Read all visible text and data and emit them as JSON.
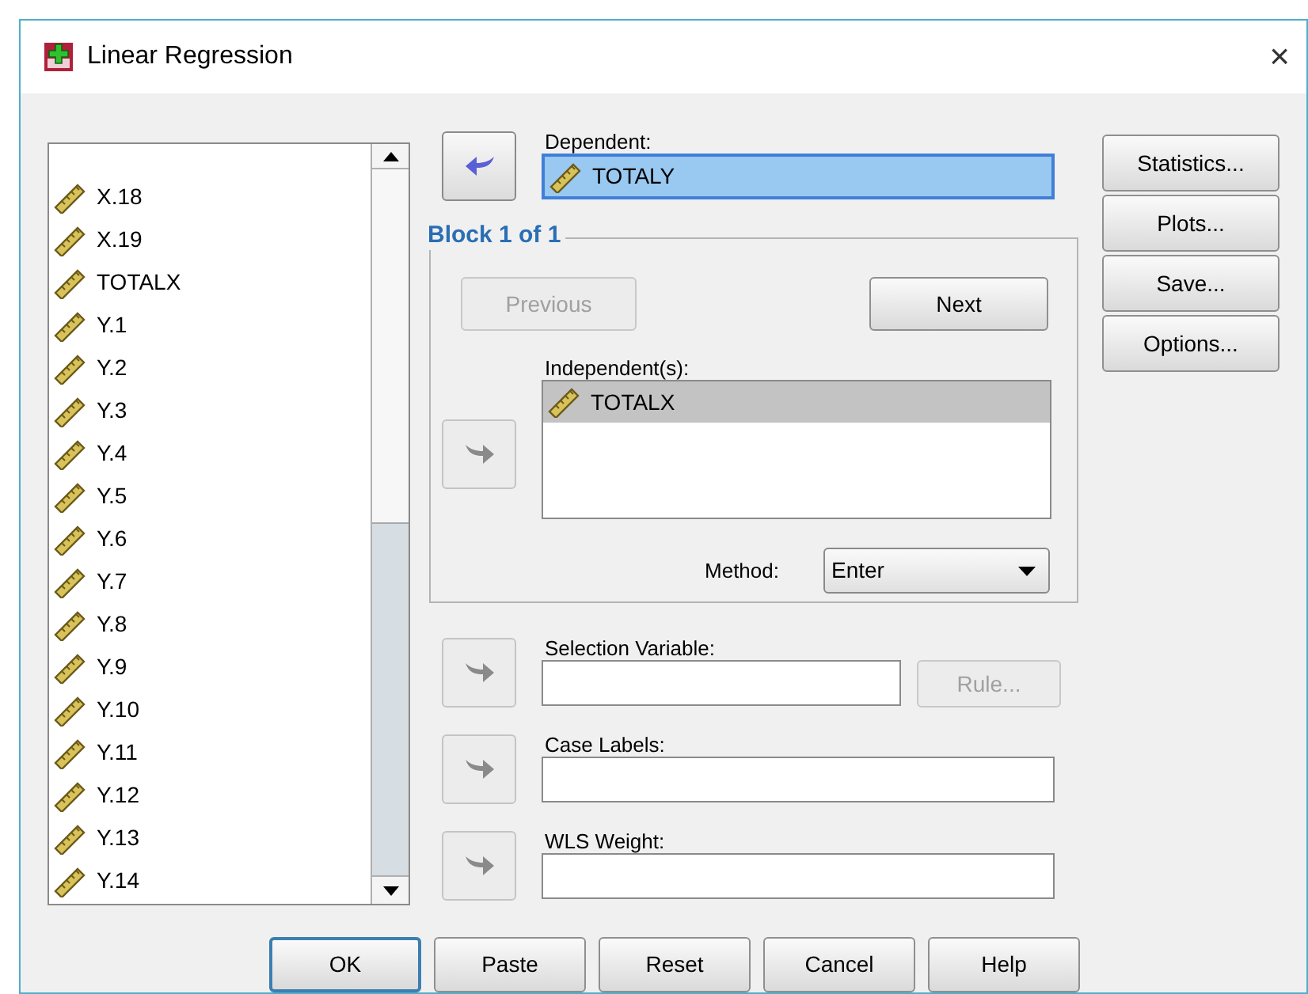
{
  "window": {
    "title": "Linear Regression",
    "close": "×"
  },
  "variables": [
    {
      "name": "X.18",
      "selected": false
    },
    {
      "name": "X.19",
      "selected": false
    },
    {
      "name": "TOTALX",
      "selected": false
    },
    {
      "name": "Y.1",
      "selected": false
    },
    {
      "name": "Y.2",
      "selected": false
    },
    {
      "name": "Y.3",
      "selected": false
    },
    {
      "name": "Y.4",
      "selected": false
    },
    {
      "name": "Y.5",
      "selected": false
    },
    {
      "name": "Y.6",
      "selected": false
    },
    {
      "name": "Y.7",
      "selected": false
    },
    {
      "name": "Y.8",
      "selected": false
    },
    {
      "name": "Y.9",
      "selected": false
    },
    {
      "name": "Y.10",
      "selected": false
    },
    {
      "name": "Y.11",
      "selected": false
    },
    {
      "name": "Y.12",
      "selected": false
    },
    {
      "name": "Y.13",
      "selected": false
    },
    {
      "name": "Y.14",
      "selected": false
    }
  ],
  "dependent": {
    "label": "Dependent:",
    "value": "TOTALY",
    "arrow_button": {
      "kind": "left",
      "enabled": true
    }
  },
  "block": {
    "title": "Block 1 of 1",
    "previous": {
      "label": "Previous",
      "disabled": true
    },
    "next": {
      "label": "Next",
      "disabled": false
    },
    "independents": {
      "label": "Independent(s):",
      "arrow_button": {
        "kind": "right",
        "enabled": false
      },
      "items": [
        {
          "name": "TOTALX",
          "selected": true
        }
      ]
    },
    "method": {
      "label": "Method:",
      "value": "Enter"
    }
  },
  "selection_variable": {
    "label": "Selection Variable:",
    "arrow_button": {
      "kind": "right",
      "enabled": false
    },
    "rule_button": {
      "label": "Rule...",
      "disabled": true
    }
  },
  "case_labels": {
    "label": "Case Labels:",
    "arrow_button": {
      "kind": "right",
      "enabled": false
    }
  },
  "wls_weight": {
    "label": "WLS Weight:",
    "arrow_button": {
      "kind": "right",
      "enabled": false
    }
  },
  "side_buttons": [
    {
      "label": "Statistics..."
    },
    {
      "label": "Plots..."
    },
    {
      "label": "Save..."
    },
    {
      "label": "Options..."
    }
  ],
  "buttons": [
    {
      "label": "OK",
      "default": true
    },
    {
      "label": "Paste",
      "default": false
    },
    {
      "label": "Reset",
      "default": false
    },
    {
      "label": "Cancel",
      "default": false
    },
    {
      "label": "Help",
      "default": false
    }
  ]
}
